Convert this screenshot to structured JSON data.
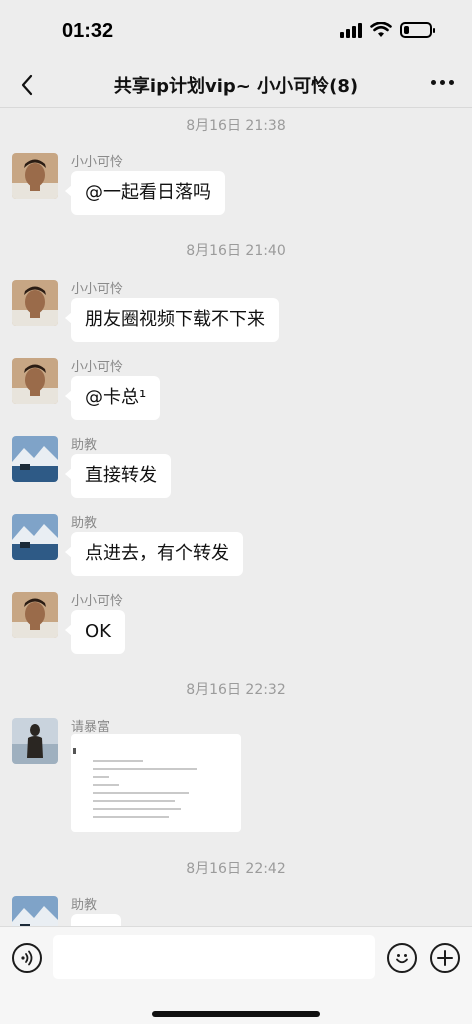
{
  "status_bar": {
    "time": "01:32",
    "signal_icon": "cellular-signal-icon",
    "wifi_icon": "wifi-icon",
    "battery_icon": "battery-icon",
    "battery_level": 0.2
  },
  "nav": {
    "title": "共享ip计划vip~ 小小可怜(8)",
    "back_icon": "chevron-left-icon",
    "more_icon": "more-dots-icon"
  },
  "timestamps": [
    "8月16日 21:38",
    "8月16日 21:40",
    "8月16日 22:32",
    "8月16日 22:42"
  ],
  "messages": [
    {
      "sender": "小小可怜",
      "text": "@一起看日落吗",
      "avatar": "man-portrait-avatar"
    },
    {
      "sender": "小小可怜",
      "text": "朋友圈视频下载不下来",
      "avatar": "man-portrait-avatar"
    },
    {
      "sender": "小小可怜",
      "text": "@卡总¹",
      "avatar": "man-portrait-avatar"
    },
    {
      "sender": "助教",
      "text": "直接转发",
      "avatar": "mountain-lake-avatar"
    },
    {
      "sender": "助教",
      "text": "点进去，有个转发",
      "avatar": "mountain-lake-avatar"
    },
    {
      "sender": "小小可怜",
      "text": "OK",
      "avatar": "man-portrait-avatar"
    },
    {
      "sender": "请暴富",
      "text": "",
      "type": "image",
      "avatar": "woman-silhouette-avatar"
    },
    {
      "sender": "助教",
      "text": "",
      "avatar": "mountain-lake-avatar"
    }
  ],
  "input_bar": {
    "voice_icon": "voice-icon",
    "emoji_icon": "emoji-smile-icon",
    "plus_icon": "plus-circle-icon",
    "placeholder": ""
  },
  "colors": {
    "background": "#ededed",
    "bubble": "#ffffff",
    "timestamp": "#9b9b9b"
  }
}
